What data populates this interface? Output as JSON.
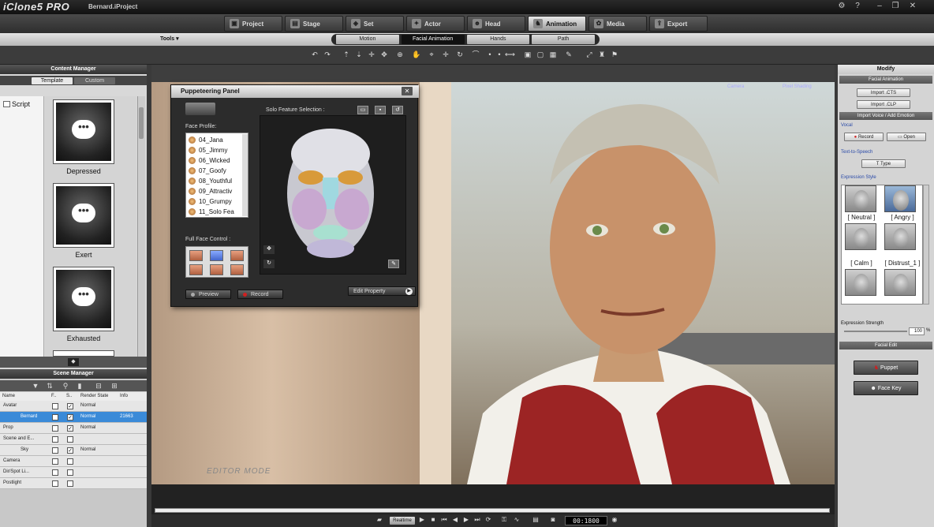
{
  "titlebar": {
    "app_name": "iClone5 PRO",
    "project": "Bernard.iProject"
  },
  "main_tabs": [
    {
      "label": "Project",
      "active": false
    },
    {
      "label": "Stage",
      "active": false
    },
    {
      "label": "Set",
      "active": false
    },
    {
      "label": "Actor",
      "active": false
    },
    {
      "label": "Head",
      "active": false
    },
    {
      "label": "Animation",
      "active": true
    },
    {
      "label": "Media",
      "active": false
    },
    {
      "label": "Export",
      "active": false
    }
  ],
  "subbar": {
    "tools_label": "Tools ▾",
    "tabs": [
      {
        "label": "Motion",
        "active": false
      },
      {
        "label": "Facial Animation",
        "active": true
      },
      {
        "label": "Hands",
        "active": false
      },
      {
        "label": "Path",
        "active": false
      }
    ]
  },
  "content_manager": {
    "title": "Content Manager",
    "tabs": [
      {
        "label": "Template",
        "active": true
      },
      {
        "label": "Custom",
        "active": false
      }
    ],
    "tree_item": "Script",
    "items": [
      "Depressed",
      "Exert",
      "Exhausted"
    ]
  },
  "scene_manager": {
    "title": "Scene Manager",
    "columns": [
      "Name",
      "F..",
      "S..",
      "Render State",
      "Info"
    ],
    "rows": [
      {
        "name": "Avatar",
        "f": false,
        "s": true,
        "state": "Normal",
        "info": "",
        "selected": false,
        "indent": 0
      },
      {
        "name": "Bernard",
        "f": false,
        "s": true,
        "state": "Normal",
        "info": "21663",
        "selected": true,
        "indent": 1
      },
      {
        "name": "Prop",
        "f": false,
        "s": true,
        "state": "Normal",
        "info": "",
        "selected": false,
        "indent": 0
      },
      {
        "name": "Scene and E...",
        "f": false,
        "s": false,
        "state": "",
        "info": "",
        "selected": false,
        "indent": 0
      },
      {
        "name": "Sky",
        "f": false,
        "s": true,
        "state": "Normal",
        "info": "",
        "selected": false,
        "indent": 1
      },
      {
        "name": "Camera",
        "f": false,
        "s": false,
        "state": "",
        "info": "",
        "selected": false,
        "indent": 0
      },
      {
        "name": "Dir/Spot Li...",
        "f": false,
        "s": false,
        "state": "",
        "info": "",
        "selected": false,
        "indent": 0
      },
      {
        "name": "Postlight",
        "f": false,
        "s": false,
        "state": "",
        "info": "",
        "selected": false,
        "indent": 0
      }
    ]
  },
  "viewport": {
    "camera_label": "Camera",
    "shading_label": "Pixel Shading",
    "mode_label": "EDITOR MODE"
  },
  "puppeteering": {
    "title": "Puppeteering Panel",
    "close": "✕",
    "solo_label": "Solo Feature Selection :",
    "face_profile_label": "Face Profile:",
    "face_profiles": [
      "04_Jana",
      "05_Jimmy",
      "06_Wicked",
      "07_Goofy",
      "08_Youthful",
      "09_Attractiv",
      "10_Grumpy",
      "11_Solo Fea"
    ],
    "full_face_label": "Full Face Control :",
    "preview_label": "Preview",
    "record_label": "Record",
    "edit_property_label": "Edit Property"
  },
  "modify": {
    "title": "Modify",
    "facial_animation": "Facial Animation",
    "import_cts": "Import .CTS",
    "import_clp": "Import .CLP",
    "import_voice": "Import Voice / Add Emotion",
    "vocal_label": "Vocal",
    "record": "Record",
    "open": "Open",
    "tts_label": "Text-to-Speech",
    "type": "Type",
    "expression_style_label": "Expression Style",
    "expressions": [
      "[ Neutral ]",
      "[ Angry ]",
      "[ Calm ]",
      "[ Distrust_1 ]"
    ],
    "expression_strength_label": "Expression Strength",
    "expression_strength_value": "100",
    "expression_strength_unit": "%",
    "facial_edit": "Facial Edit",
    "puppet": "Puppet",
    "face_key": "Face Key"
  },
  "timeline": {
    "realtime": "Realtime",
    "frame": "00:1800"
  },
  "colors": {
    "selected_row": "#3a8ad8",
    "record_red": "#d02020",
    "link_blue": "#2a4aa8"
  }
}
